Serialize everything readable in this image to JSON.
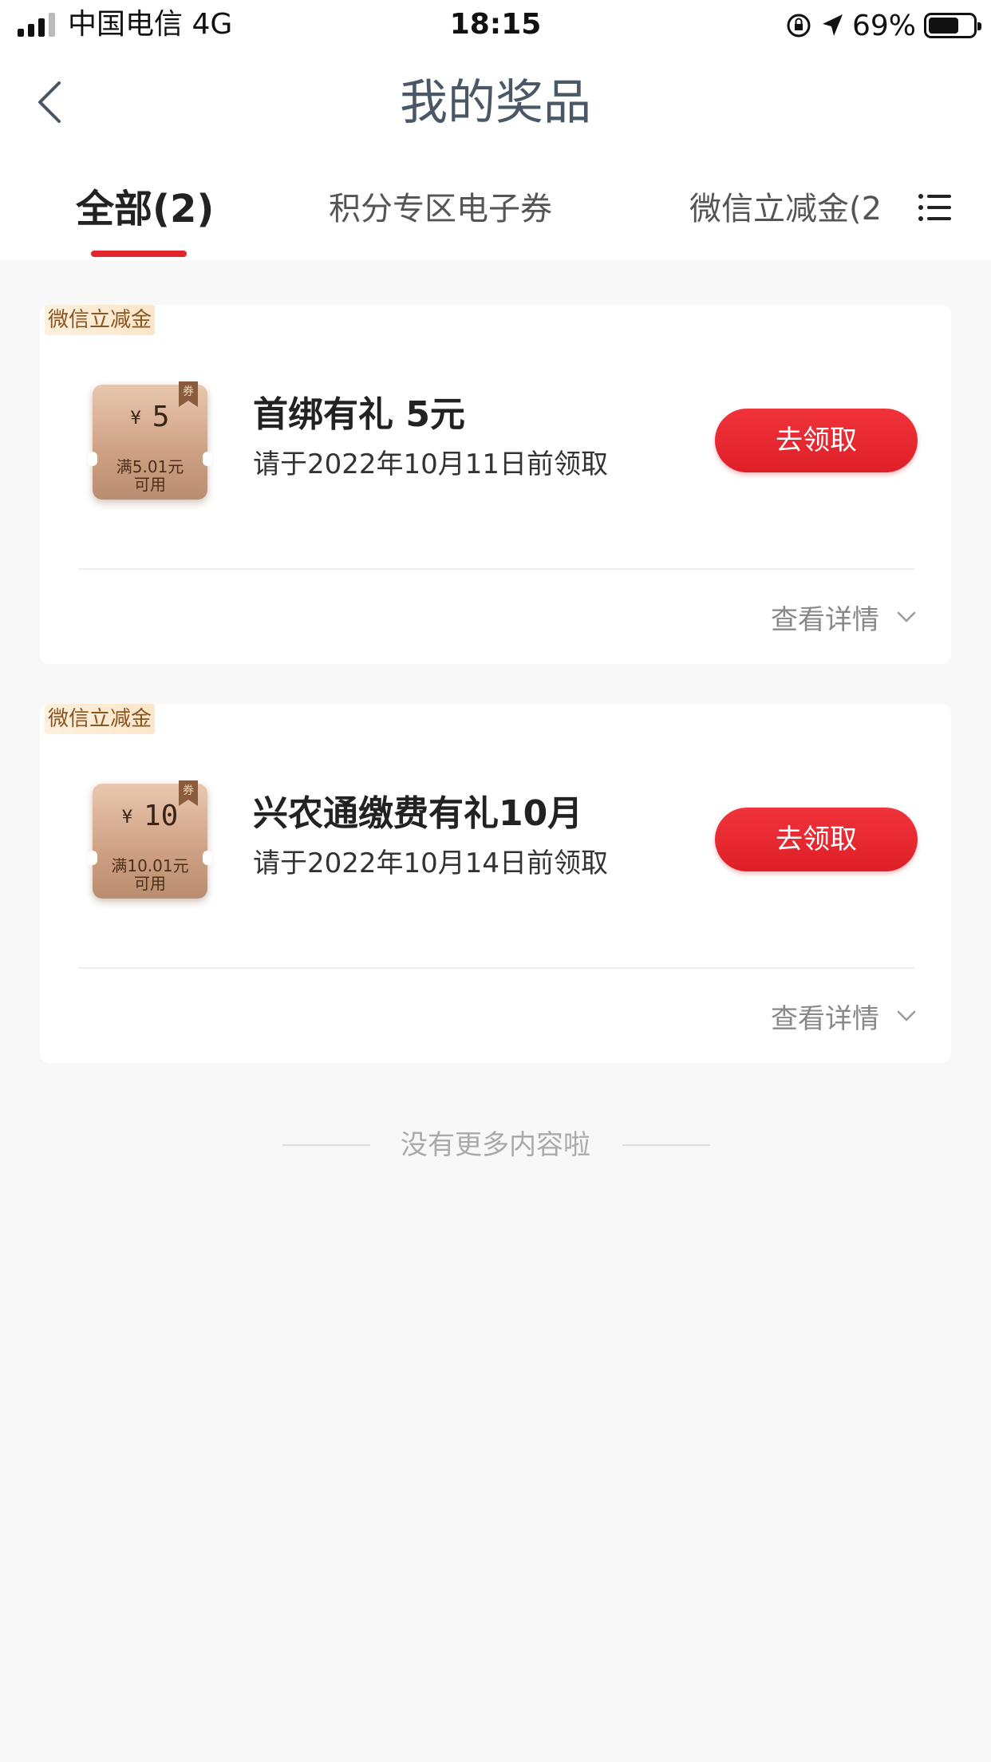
{
  "status_bar": {
    "carrier": "中国电信  4G",
    "time": "18:15",
    "battery": "69%"
  },
  "header": {
    "title": "我的奖品"
  },
  "tabs": [
    {
      "label": "全部(2)",
      "active": true
    },
    {
      "label": "积分专区电子券",
      "active": false
    },
    {
      "label": "微信立减金(2)",
      "active": false
    }
  ],
  "prizes": [
    {
      "tag": "微信立减金",
      "coupon_badge": "券",
      "coupon_currency": "¥",
      "coupon_amount": "5",
      "coupon_condition_line1": "满5.01元",
      "coupon_condition_line2": "可用",
      "name": "首绑有礼 5元",
      "deadline": "请于2022年10月11日前领取",
      "claim_label": "去领取",
      "details_label": "查看详情"
    },
    {
      "tag": "微信立减金",
      "coupon_badge": "券",
      "coupon_currency": "¥",
      "coupon_amount": "10",
      "coupon_condition_line1": "满10.01元",
      "coupon_condition_line2": "可用",
      "name": "兴农通缴费有礼10月",
      "deadline": "请于2022年10月14日前领取",
      "claim_label": "去领取",
      "details_label": "查看详情"
    }
  ],
  "footer": {
    "end_text": "没有更多内容啦"
  },
  "colors": {
    "accent_red": "#e2262c",
    "title_gray": "#4a5866",
    "tag_brown": "#8a5420"
  }
}
